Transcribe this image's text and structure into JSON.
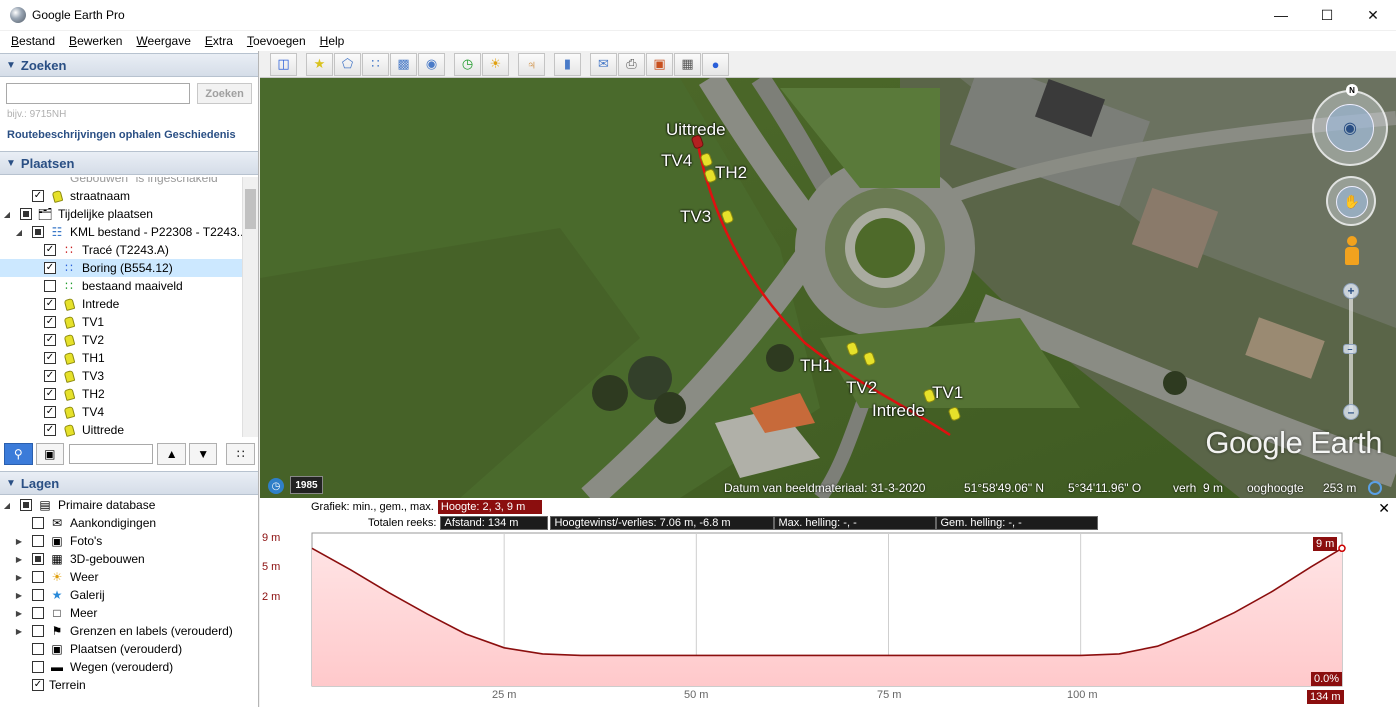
{
  "window": {
    "title": "Google Earth Pro"
  },
  "menu": [
    "Bestand",
    "Bewerken",
    "Weergave",
    "Extra",
    "Toevoegen",
    "Help"
  ],
  "search": {
    "header": "Zoeken",
    "button": "Zoeken",
    "hint": "bijv.: 9715NH",
    "links": "Routebeschrijvingen ophalen Geschiedenis"
  },
  "places": {
    "header": "Plaatsen",
    "items": [
      {
        "label": "Gebouwen\" is ingeschakeld"
      },
      {
        "label": "straatnaam"
      },
      {
        "label": "Tijdelijke plaatsen"
      },
      {
        "label": "KML bestand - P22308 - T2243..."
      },
      {
        "label": "Tracé (T2243.A)"
      },
      {
        "label": "Boring (B554.12)"
      },
      {
        "label": "bestaand maaiveld"
      },
      {
        "label": "Intrede"
      },
      {
        "label": "TV1"
      },
      {
        "label": "TV2"
      },
      {
        "label": "TH1"
      },
      {
        "label": "TV3"
      },
      {
        "label": "TH2"
      },
      {
        "label": "TV4"
      },
      {
        "label": "Uittrede"
      }
    ]
  },
  "layers": {
    "header": "Lagen",
    "items": [
      {
        "label": "Primaire database"
      },
      {
        "label": "Aankondigingen"
      },
      {
        "label": "Foto's"
      },
      {
        "label": "3D-gebouwen"
      },
      {
        "label": "Weer"
      },
      {
        "label": "Galerij"
      },
      {
        "label": "Meer"
      },
      {
        "label": "Grenzen en labels (verouderd)"
      },
      {
        "label": "Plaatsen (verouderd)"
      },
      {
        "label": "Wegen (verouderd)"
      },
      {
        "label": "Terrein"
      }
    ]
  },
  "map": {
    "labels": {
      "uittrede": "Uittrede",
      "tv4": "TV4",
      "th2": "TH2",
      "tv3": "TV3",
      "th1": "TH1",
      "tv2": "TV2",
      "tv1": "TV1",
      "intrede": "Intrede"
    },
    "logo": "Google Earth",
    "year": "1985",
    "compass_north": "N",
    "status": {
      "date": "Datum van beeldmateriaal: 31-3-2020",
      "lat": "51°58'49.06\" N",
      "lon": "5°34'11.96\" O",
      "elev_label": "verh",
      "elev": "9 m",
      "eye_label": "ooghoogte",
      "eye": "253 m"
    }
  },
  "profile": {
    "graph_label": "Grafiek: min., gem., max.",
    "height": "Hoogte: 2, 3, 9 m",
    "totals_label": "Totalen reeks:",
    "distance": "Afstand: 134 m",
    "gain": "Hoogtewinst/-verlies: 7.06 m, -6.8 m",
    "max_slope": "Max. helling: -, -",
    "avg_slope": "Gem. helling: -, -",
    "y_ticks": [
      "9 m",
      "5 m",
      "2 m"
    ],
    "x_ticks": [
      "25 m",
      "50 m",
      "75 m",
      "100 m"
    ],
    "end_value": "9 m",
    "slope_value": "0.0%",
    "end_distance": "134 m",
    "colors": {
      "line": "#8b0e0e",
      "fill": "#ffc9cb"
    }
  },
  "chart_data": {
    "type": "area",
    "x": [
      0,
      5,
      10,
      15,
      20,
      25,
      30,
      35,
      40,
      50,
      60,
      70,
      80,
      90,
      100,
      105,
      110,
      115,
      120,
      125,
      130,
      134
    ],
    "values": [
      9,
      7.6,
      6.1,
      4.7,
      3.4,
      2.5,
      2.1,
      2.0,
      2.0,
      2.0,
      2.0,
      2.0,
      2.0,
      2.0,
      2.0,
      2.1,
      2.6,
      3.6,
      4.8,
      6.2,
      7.8,
      9
    ],
    "ylim": [
      0,
      10
    ],
    "xlim": [
      0,
      134
    ],
    "xlabel": "",
    "ylabel": ""
  }
}
